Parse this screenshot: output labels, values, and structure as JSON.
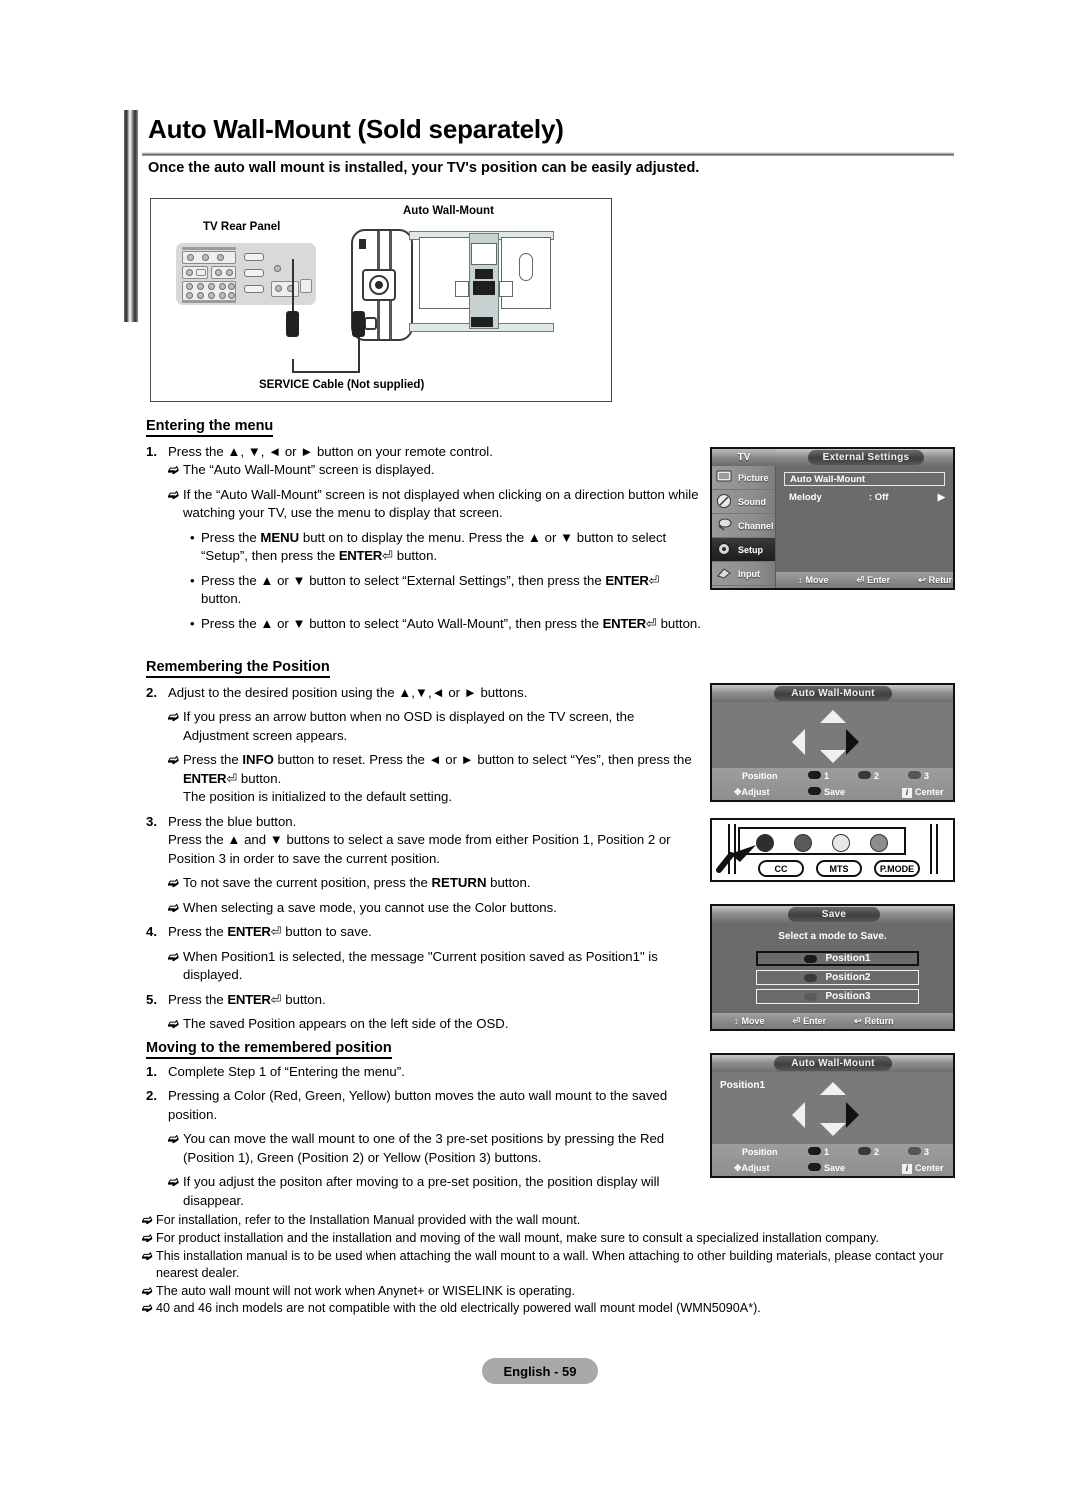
{
  "header": {
    "title": "Auto Wall-Mount (Sold separately)",
    "subtitle": "Once the auto wall mount is installed, your TV's position can be easily adjusted."
  },
  "figure": {
    "label_wall_mount": "Auto Wall-Mount",
    "label_rear_panel": "TV Rear Panel",
    "label_cable": "SERVICE Cable (Not supplied)"
  },
  "sections": {
    "entering": {
      "heading": "Entering the menu",
      "step1_num": "1.",
      "step1_text": "Press the ▲, ▼, ◄ or ► button on your remote control.",
      "bullet1": "The “Auto Wall-Mount” screen is displayed.",
      "bullet2": "If the “Auto Wall-Mount” screen is not displayed when clicking on a direction button while watching your TV, use the menu to display that screen.",
      "sub1_a": "Press the ",
      "sub1_menu": "MENU",
      "sub1_b": " butt on to display the menu. Press the ▲ or ▼ button to select “Setup”, then press the ",
      "sub1_enter": "ENTER",
      "sub1_c": " button.",
      "sub2_a": "Press the ▲ or ▼ button to select “External Settings”, then press the ",
      "sub2_enter": "ENTER",
      "sub2_b": " button.",
      "sub3_a": "Press the ▲ or ▼ button to select “Auto Wall-Mount”, then press the ",
      "sub3_enter": "ENTER",
      "sub3_b": " button."
    },
    "remembering": {
      "heading": "Remembering the Position",
      "step2_num": "2.",
      "step2_text": "Adjust to the desired position using the ▲,▼,◄ or ► buttons.",
      "bullet1": "If you press an arrow button when no OSD is displayed on the TV screen, the Adjustment screen appears.",
      "bullet2_a": "Press the ",
      "bullet2_info": "INFO",
      "bullet2_b": " button to reset. Press the ◄ or ► button to select “Yes”, then press the ",
      "bullet2_enter": "ENTER",
      "bullet2_c": " button.",
      "bullet2_d": "The position is initialized to the default setting.",
      "step3_num": "3.",
      "step3_line1": "Press the blue button.",
      "step3_line2": "Press the ▲ and ▼ buttons to select a save mode from either Position 1, Position 2 or Position 3 in order to save the current position.",
      "bullet3_a": "To not save the current position, press the ",
      "bullet3_return": "RETURN",
      "bullet3_b": " button.",
      "bullet4": "When selecting a save mode, you cannot use the Color buttons.",
      "step4_num": "4.",
      "step4_a": "Press the ",
      "step4_enter": "ENTER",
      "step4_b": " button to save.",
      "bullet5": "When Position1 is selected, the message \"Current position saved as Position1\" is displayed.",
      "step5_num": "5.",
      "step5_a": "Press the ",
      "step5_enter": "ENTER",
      "step5_b": " button.",
      "bullet6": "The saved Position appears on the left side of the OSD."
    },
    "moving": {
      "heading": "Moving to the remembered position",
      "step1_num": "1.",
      "step1_text": "Complete Step 1 of “Entering the menu”.",
      "step2_num": "2.",
      "step2_text": "Pressing a Color (Red, Green, Yellow) button moves the auto wall mount to the saved position.",
      "bullet1": "You can move the wall mount to one of the 3 pre-set positions by pressing the Red (Position 1), Green (Position 2) or Yellow (Position 3) buttons.",
      "bullet2": "If you adjust the positon after moving to a pre-set position, the position display will disappear."
    }
  },
  "osd_menu": {
    "tv_label": "TV",
    "title": "External Settings",
    "sidebar": [
      "Picture",
      "Sound",
      "Channel",
      "Setup",
      "Input"
    ],
    "active_sidebar": "Setup",
    "items": [
      {
        "label": "Auto Wall-Mount",
        "value": "",
        "selected": true
      },
      {
        "label": "Melody",
        "value": ": Off",
        "selected": false
      }
    ],
    "footer": [
      {
        "icon": "updown-icon",
        "label": "Move"
      },
      {
        "icon": "enter-icon",
        "label": "Enter"
      },
      {
        "icon": "return-icon",
        "label": "Return"
      }
    ]
  },
  "osd_adjust": {
    "title": "Auto Wall-Mount",
    "position_label": "",
    "status": {
      "position_label": "Position",
      "positions": [
        "1",
        "2",
        "3"
      ],
      "adjust_label": "Adjust",
      "save_label": "Save",
      "center_label": "Center"
    }
  },
  "osd_adjust_saved": {
    "title": "Auto Wall-Mount",
    "position_label": "Position1",
    "status": {
      "position_label": "Position",
      "positions": [
        "1",
        "2",
        "3"
      ],
      "adjust_label": "Adjust",
      "save_label": "Save",
      "center_label": "Center"
    }
  },
  "remote": {
    "color_buttons": [
      "red-button",
      "green-button",
      "yellow-button",
      "blue-button"
    ],
    "buttons": [
      "CC",
      "MTS",
      "P.MODE"
    ]
  },
  "osd_save": {
    "title": "Save",
    "prompt": "Select a mode to Save.",
    "options": [
      "Position1",
      "Position2",
      "Position3"
    ],
    "selected": "Position1",
    "footer": [
      {
        "icon": "updown-icon",
        "label": "Move"
      },
      {
        "icon": "enter-icon",
        "label": "Enter"
      },
      {
        "icon": "return-icon",
        "label": "Return"
      }
    ]
  },
  "notes": [
    "For installation, refer to the Installation Manual provided with the wall mount.",
    "For product installation and the installation and moving of the wall mount, make sure to consult a specialized installation company.",
    "This installation manual is to be used when attaching the wall mount to a wall. When attaching to other building materials, please contact your nearest dealer.",
    "The auto wall mount will not work when Anynet+ or WISELINK is operating.",
    "40 and 46 inch models are not compatible with the old electrically powered wall mount model (WMN5090A*)."
  ],
  "page_footer": "English - 59",
  "colors": {
    "osd_bg": "#6b6b6b",
    "osd_panel": "#8c8c8c",
    "accent_dark": "#1d1d1d"
  }
}
